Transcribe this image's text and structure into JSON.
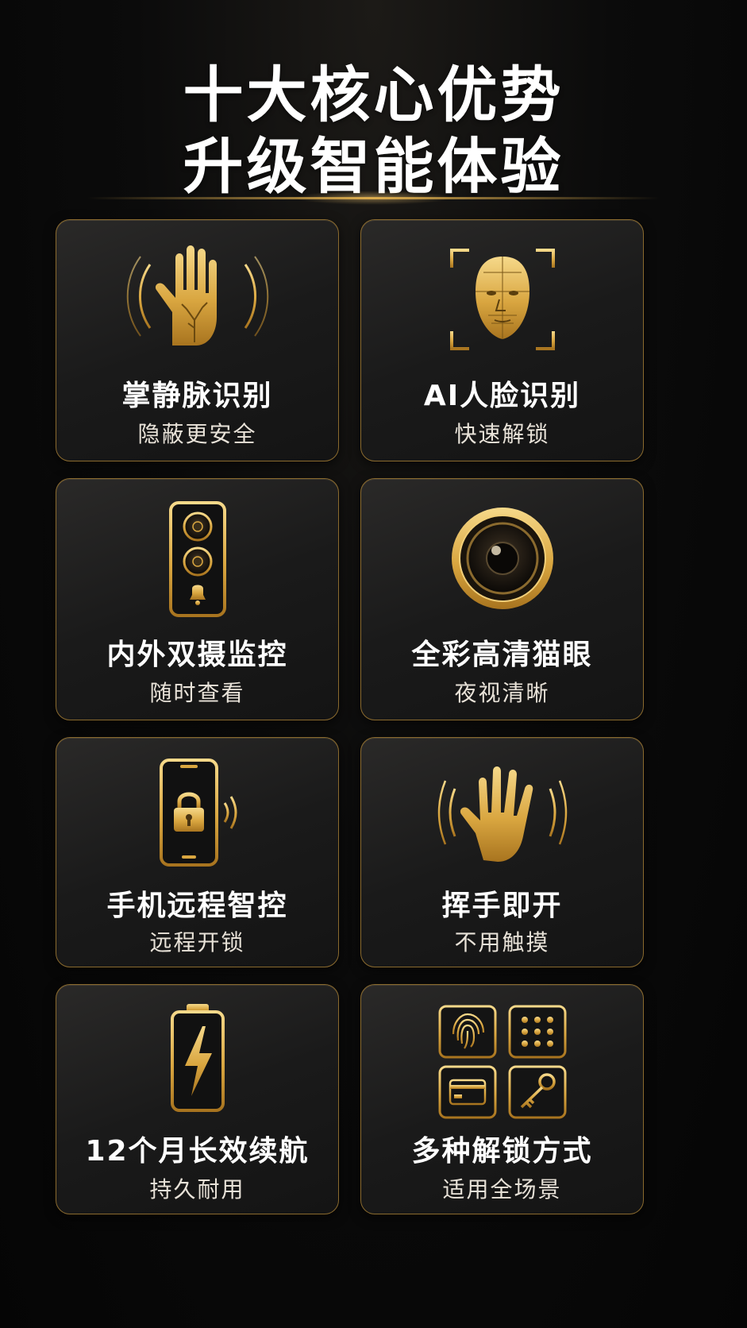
{
  "header": {
    "title_line1": "十大核心优势",
    "title_line2": "升级智能体验"
  },
  "colors": {
    "background": "#0b0b0b",
    "gold": "#d9a640",
    "gold_light": "#f2cf78",
    "card_border": "#8a6a2e",
    "text_primary": "#ffffff",
    "text_secondary": "#e8e2d8"
  },
  "features": [
    {
      "icon": "palm-vein-icon",
      "title": "掌静脉识别",
      "subtitle": "隐蔽更安全"
    },
    {
      "icon": "face-recognition-icon",
      "title": "AI人脸识别",
      "subtitle": "快速解锁"
    },
    {
      "icon": "dual-camera-doorbell-icon",
      "title": "内外双摄监控",
      "subtitle": "随时查看"
    },
    {
      "icon": "peephole-camera-icon",
      "title": "全彩高清猫眼",
      "subtitle": "夜视清晰"
    },
    {
      "icon": "phone-lock-icon",
      "title": "手机远程智控",
      "subtitle": "远程开锁"
    },
    {
      "icon": "wave-hand-icon",
      "title": "挥手即开",
      "subtitle": "不用触摸"
    },
    {
      "icon": "battery-icon",
      "title": "12个月长效续航",
      "subtitle": "持久耐用"
    },
    {
      "icon": "unlock-methods-icon",
      "title": "多种解锁方式",
      "subtitle": "适用全场景"
    }
  ]
}
